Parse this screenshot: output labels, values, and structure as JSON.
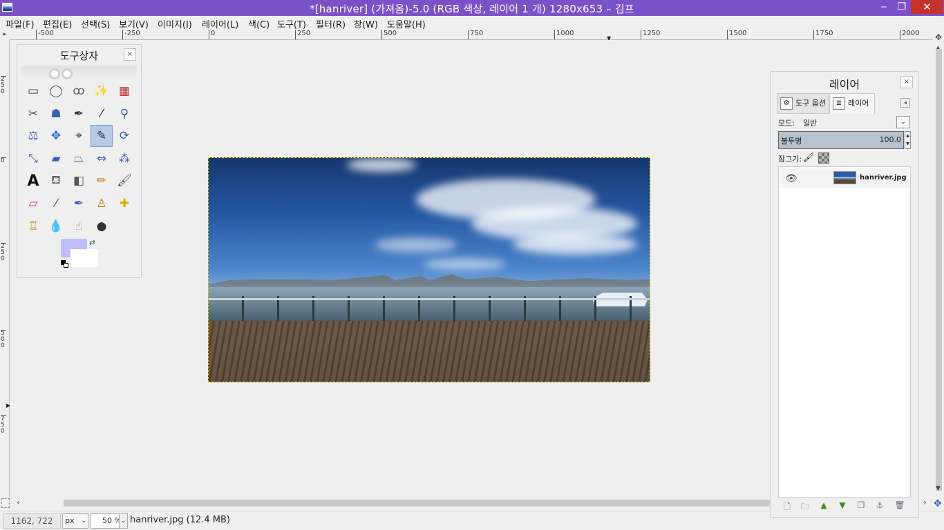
{
  "window": {
    "title": "*[hanriver] (가져옴)-5.0 (RGB 색상, 레이어 1 개) 1280x653 – 김프",
    "minimize": "‒",
    "maximize": "❐",
    "close": "✕"
  },
  "menu": [
    "파일(F)",
    "편집(E)",
    "선택(S)",
    "보기(V)",
    "이미지(I)",
    "레이어(L)",
    "색(C)",
    "도구(T)",
    "필터(R)",
    "창(W)",
    "도움말(H)"
  ],
  "ruler": {
    "h_labels": [
      "-500",
      "-250",
      "0",
      "250",
      "500",
      "750",
      "1000",
      "1250",
      "1500",
      "1750",
      "2000"
    ],
    "v_labels": [
      "250",
      "0",
      "250",
      "500",
      "750"
    ]
  },
  "toolbox": {
    "title": "도구상자",
    "close": "×",
    "tools": [
      {
        "name": "rect-select-icon",
        "glyph": "▭"
      },
      {
        "name": "ellipse-select-icon",
        "glyph": "◯"
      },
      {
        "name": "free-select-icon",
        "glyph": "ꝏ"
      },
      {
        "name": "fuzzy-select-icon",
        "glyph": "✨"
      },
      {
        "name": "select-by-color-icon",
        "glyph": "▦"
      },
      {
        "name": "scissors-select-icon",
        "glyph": "✂"
      },
      {
        "name": "foreground-select-icon",
        "glyph": "☗"
      },
      {
        "name": "paths-icon",
        "glyph": "✒"
      },
      {
        "name": "color-picker-icon",
        "glyph": "⁄"
      },
      {
        "name": "zoom-icon",
        "glyph": "⚲"
      },
      {
        "name": "measure-icon",
        "glyph": "⚖"
      },
      {
        "name": "move-icon",
        "glyph": "✥"
      },
      {
        "name": "align-icon",
        "glyph": "⌖"
      },
      {
        "name": "crop-icon",
        "glyph": "✎"
      },
      {
        "name": "rotate-icon",
        "glyph": "⟳"
      },
      {
        "name": "scale-icon",
        "glyph": "⤡"
      },
      {
        "name": "shear-icon",
        "glyph": "▰"
      },
      {
        "name": "perspective-icon",
        "glyph": "⏢"
      },
      {
        "name": "flip-icon",
        "glyph": "⇔"
      },
      {
        "name": "cage-transform-icon",
        "glyph": "⁂"
      },
      {
        "name": "text-icon",
        "glyph": "A"
      },
      {
        "name": "bucket-fill-icon",
        "glyph": "⛾"
      },
      {
        "name": "blend-icon",
        "glyph": "◧"
      },
      {
        "name": "pencil-icon",
        "glyph": "✏"
      },
      {
        "name": "paintbrush-icon",
        "glyph": "🖌"
      },
      {
        "name": "eraser-icon",
        "glyph": "▱"
      },
      {
        "name": "airbrush-icon",
        "glyph": "⁄"
      },
      {
        "name": "ink-icon",
        "glyph": "✒"
      },
      {
        "name": "clone-icon",
        "glyph": "♙"
      },
      {
        "name": "heal-icon",
        "glyph": "✚"
      },
      {
        "name": "perspective-clone-icon",
        "glyph": "♖"
      },
      {
        "name": "blur-icon",
        "glyph": "💧"
      },
      {
        "name": "smudge-icon",
        "glyph": "☝"
      },
      {
        "name": "dodge-burn-icon",
        "glyph": "●"
      }
    ],
    "colors": {
      "foreground": "#bfbffb",
      "background": "#ffffff"
    }
  },
  "canvas": {
    "image": "hanriver.jpg"
  },
  "statusbar": {
    "coords": "1162, 722",
    "unit": "px",
    "zoom": "50 %",
    "file": "hanriver.jpg (12.4 MB)"
  },
  "layers": {
    "title": "레이어",
    "close": "×",
    "tabs": [
      {
        "label": "도구 옵션",
        "icon": "tool-options-icon"
      },
      {
        "label": "레이어",
        "icon": "layers-icon"
      }
    ],
    "mode_label": "모드:",
    "mode_value": "일반",
    "opacity_label": "불투명",
    "opacity_value": "100.0",
    "lock_label": "잠그기:",
    "layer_name": "hanriver.jpg",
    "buttons": [
      "new-layer-icon",
      "new-layer-group-icon",
      "raise-layer-icon",
      "lower-layer-icon",
      "duplicate-layer-icon",
      "anchor-layer-icon",
      "delete-layer-icon"
    ]
  }
}
